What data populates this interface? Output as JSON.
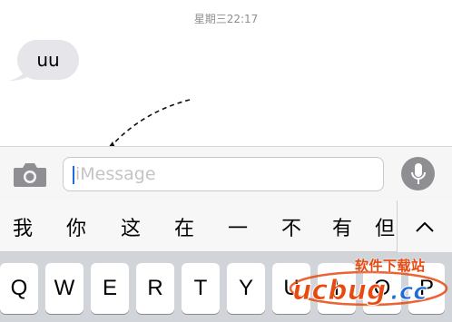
{
  "conversation": {
    "timestamp": "星期三22:17",
    "messages": [
      {
        "direction": "incoming",
        "text": "uu"
      }
    ]
  },
  "input_bar": {
    "camera_icon": "camera-icon",
    "placeholder": "iMessage",
    "value": "",
    "mic_icon": "microphone-icon"
  },
  "candidates": {
    "items": [
      "我",
      "你",
      "这",
      "在",
      "一",
      "不",
      "有",
      "但"
    ],
    "collapse_icon": "chevron-up-icon"
  },
  "keyboard": {
    "row1": [
      "Q",
      "W",
      "E",
      "R",
      "T",
      "Y",
      "U",
      "I",
      "O",
      "P"
    ]
  },
  "watermark": {
    "site_name": "软件下载站",
    "logo_text": "ucbug.cc"
  },
  "colors": {
    "accent": "#1f6bdb",
    "bubble_gray": "#e5e5ea",
    "keyboard_bg": "#d1d4d9"
  }
}
